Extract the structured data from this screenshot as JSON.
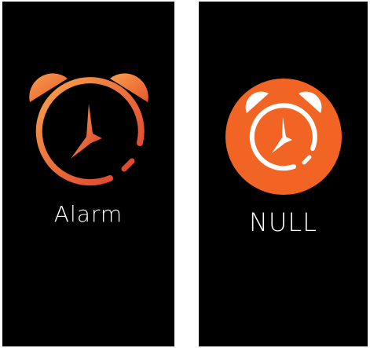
{
  "screens": [
    {
      "label": "Alarm",
      "icon": "alarm-clock-icon",
      "style": "gradient-outline",
      "colors": {
        "start": "#f6a04a",
        "end": "#e0402c"
      }
    },
    {
      "label": "NULL",
      "icon": "alarm-clock-icon",
      "style": "filled-circle",
      "colors": {
        "circle": "#f26424",
        "glyph": "#ffffff"
      }
    }
  ]
}
